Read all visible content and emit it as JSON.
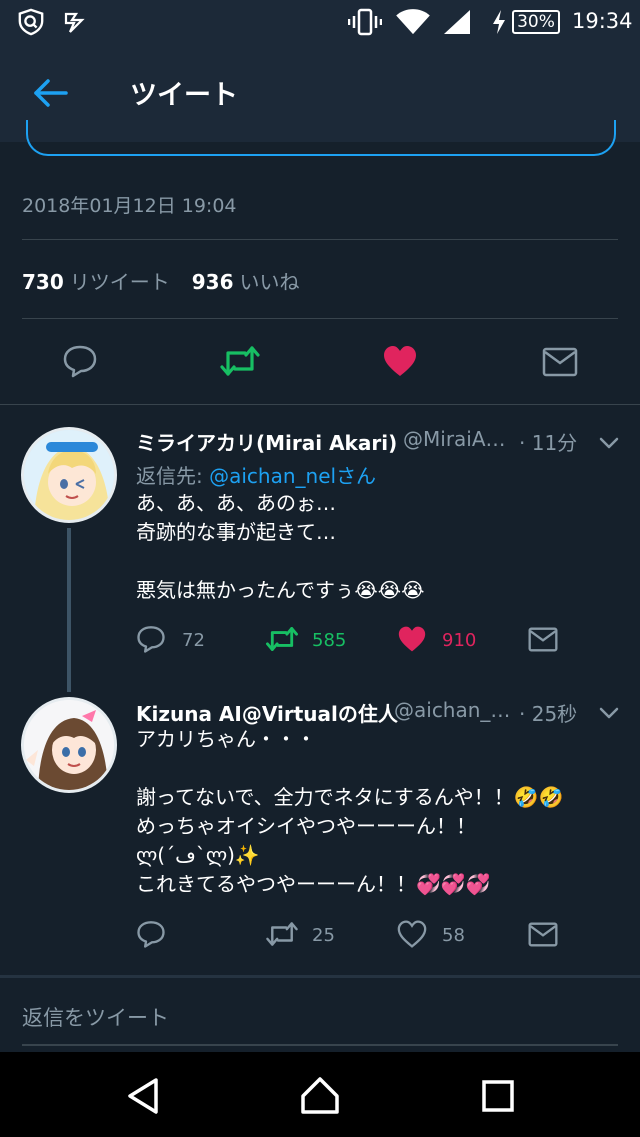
{
  "status_bar": {
    "battery": "30%",
    "time": "19:34"
  },
  "header": {
    "title": "ツイート"
  },
  "tweet": {
    "timestamp": "2018年01月12日 19:04",
    "retweets": "730",
    "retweets_label": "リツイート",
    "likes": "936",
    "likes_label": "いいね"
  },
  "replies": [
    {
      "name": "ミライアカリ(Mirai Akari)",
      "handle": "@MiraiA…",
      "time": "· 11分",
      "reply_to_prefix": "返信先: ",
      "reply_to_handle": "@aichan_nelさん",
      "text": "あ、あ、あ、あのぉ…\n奇跡的な事が起きて…\n\n悪気は無かったんですぅ😭😭😭",
      "replies": "72",
      "retweets": "585",
      "likes": "910"
    },
    {
      "name": "Kizuna AI@Virtualの住人",
      "handle": "@aichan_…",
      "time": "· 25秒",
      "text": "アカリちゃん・・・\n\n謝ってないで、全力でネタにするんや！！🤣🤣\nめっちゃオイシイやつやーーーん！！\nლ(´ڡ`ლ)✨\nこれきてるやつやーーーん！！💞💞💞",
      "replies": "",
      "retweets": "25",
      "likes": "58"
    }
  ],
  "compose": {
    "placeholder": "返信をツイート"
  },
  "colors": {
    "accent": "#1da1f2",
    "retweet": "#17bf63",
    "like": "#e0245e",
    "muted": "#8899a6",
    "background": "#15202b"
  }
}
